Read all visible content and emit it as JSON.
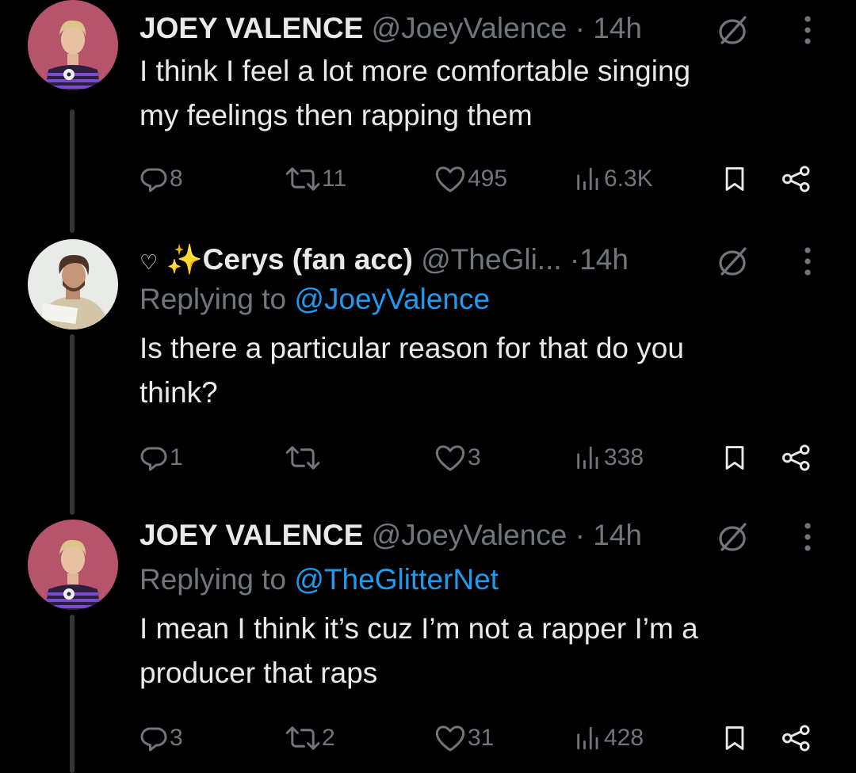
{
  "tweets": [
    {
      "name": "JOEY VALENCE",
      "handle": "@JoeyValence",
      "dot": "·",
      "time": "14h",
      "text_lines": [
        "I think I feel a lot more comfortable singing",
        "my feelings then rapping them"
      ],
      "reply_count": "8",
      "retweet_count": "11",
      "like_count": "495",
      "view_count": "6.3K"
    },
    {
      "name_prefix": "♡",
      "sparkle": "✨",
      "name": "Cerys (fan acc)",
      "handle": "@TheGli...",
      "dot": "·",
      "time": "14h",
      "replying_label": "Replying to",
      "replying_to": "@JoeyValence",
      "text_lines": [
        "Is there a particular reason for that do you",
        "think?"
      ],
      "reply_count": "1",
      "retweet_count": "",
      "like_count": "3",
      "view_count": "338"
    },
    {
      "name": "JOEY VALENCE",
      "handle": "@JoeyValence",
      "dot": "·",
      "time": "14h",
      "replying_label": "Replying to",
      "replying_to": "@TheGlitterNet",
      "text_lines": [
        "I mean I think it’s cuz I’m not a rapper I’m a",
        "producer that raps"
      ],
      "reply_count": "3",
      "retweet_count": "2",
      "like_count": "31",
      "view_count": "428"
    }
  ],
  "icons": {
    "reply": "reply-icon",
    "retweet": "retweet-icon",
    "like": "heart-icon",
    "views": "views-icon",
    "bookmark": "bookmark-icon",
    "share": "share-icon",
    "verified": "verified-badge-icon",
    "more": "more-options-icon"
  },
  "colors": {
    "background": "#000000",
    "text": "#e7e9ea",
    "muted": "#71767b",
    "link": "#1d9bf0",
    "thread_line": "#333639"
  }
}
